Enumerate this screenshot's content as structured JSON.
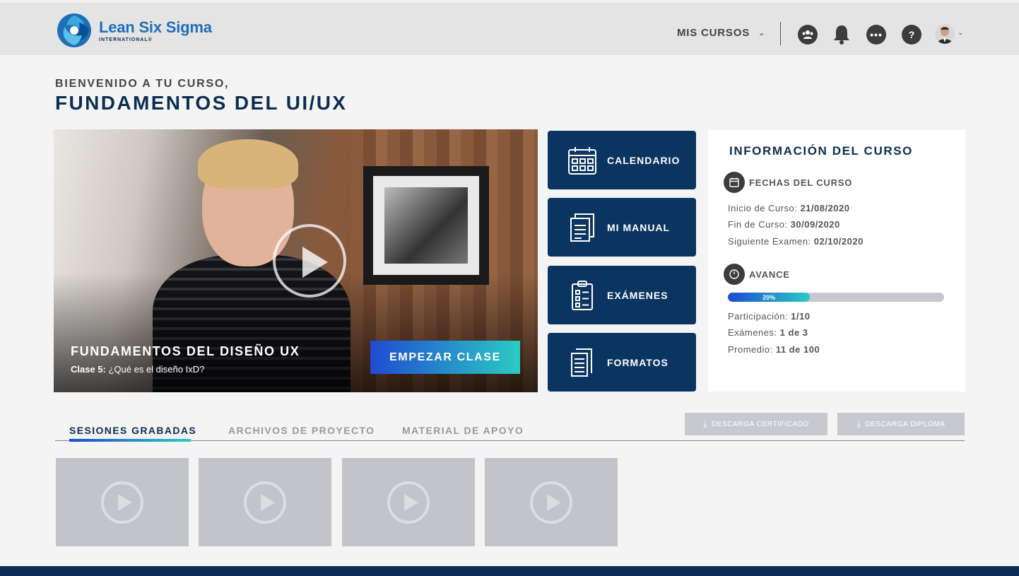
{
  "brand": {
    "title": "Lean Six Sigma",
    "subtitle": "INTERNATIONAL®"
  },
  "nav": {
    "mis_cursos": "MIS CURSOS"
  },
  "welcome": {
    "line1": "BIENVENIDO A TU CURSO,",
    "course": "FUNDAMENTOS DEL UI/UX"
  },
  "video": {
    "title": "FUNDAMENTOS DEL DISEÑO UX",
    "class_label": "Clase 5:",
    "class_name": " ¿Qué es el diseño IxD?",
    "button": "EMPEZAR CLASE"
  },
  "quick": [
    {
      "label": "CALENDARIO",
      "icon": "calendar-icon"
    },
    {
      "label": "MI MANUAL",
      "icon": "manual-icon"
    },
    {
      "label": "EXÁMENES",
      "icon": "checklist-icon"
    },
    {
      "label": "FORMATOS",
      "icon": "document-icon"
    }
  ],
  "info": {
    "title": "INFORMACIÓN DEL CURSO",
    "dates_head": "FECHAS DEL CURSO",
    "start_label": "Inicio de Curso: ",
    "start": "21/08/2020",
    "end_label": "Fin de Curso: ",
    "end": "30/09/2020",
    "exam_label": "Siguiente Examen: ",
    "exam": "02/10/2020",
    "progress_head": "AVANCE",
    "progress_text": "20%",
    "progress_value": 0.2,
    "part_label": "Participación: ",
    "part": "1/10",
    "exams_label": "Exámenes: ",
    "exams": "1 de 3",
    "avg_label": "Promedio: ",
    "avg": "11 de 100"
  },
  "tabs": [
    "SESIONES GRABADAS",
    "ARCHIVOS DE PROYECTO",
    "MATERIAL DE APOYO"
  ],
  "downloads": {
    "cert": "DESCARGA CERTIFICADO",
    "diploma": "DESCARGA  DIPLOMA"
  },
  "colors": {
    "primary": "#0b3561",
    "accent_start": "#1f4bd1",
    "accent_end": "#2bcbc4"
  }
}
